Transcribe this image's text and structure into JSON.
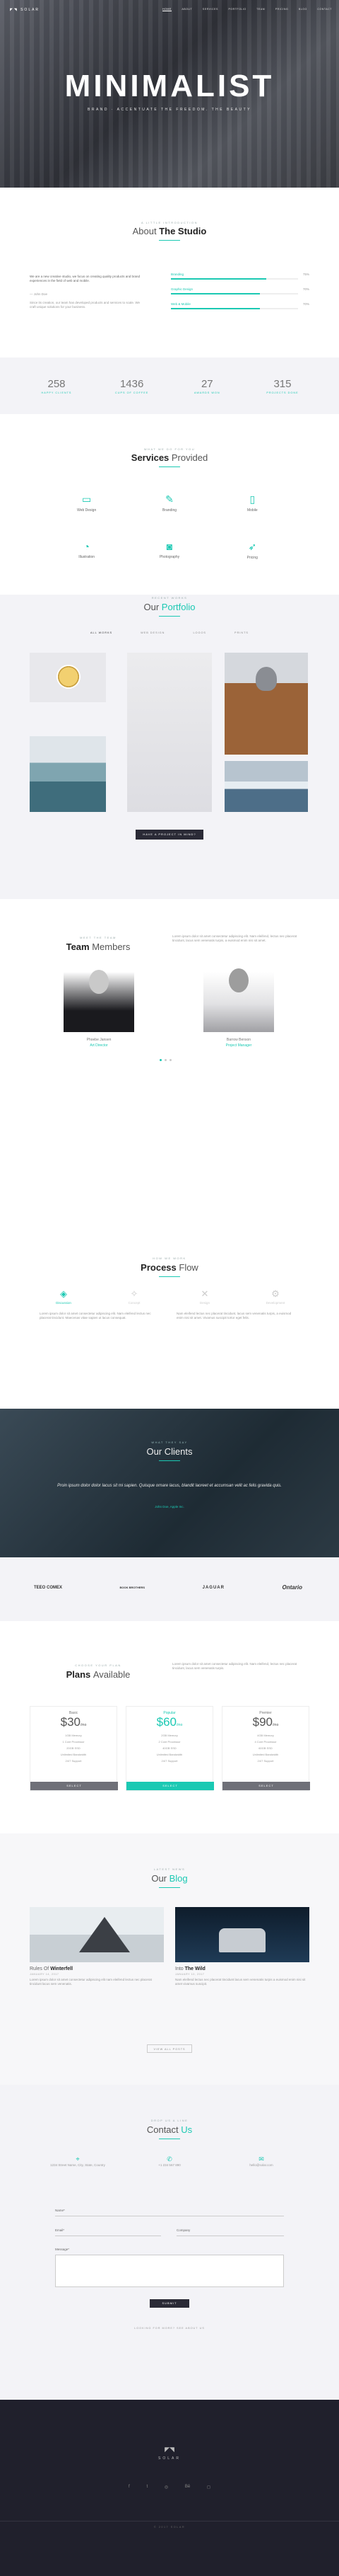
{
  "colors": {
    "accent": "#1bc9b3",
    "dark": "#222230",
    "light_bg": "#f3f3f7"
  },
  "nav": {
    "logo": "SOLAR",
    "items": [
      "HOME",
      "ABOUT",
      "SERVICES",
      "PORTFOLIO",
      "TEAM",
      "PRICING",
      "BLOG",
      "CONTACT"
    ]
  },
  "hero": {
    "title": "MINIMALIST",
    "subtitle": "BRAND · ACCENTUATE THE FREEDOM. THE BEAUTY"
  },
  "about": {
    "kicker": "A LITTLE INTRODUCTION",
    "title_a": "About ",
    "title_b": "The Studio",
    "quote": "We are a new creative studio, we focus on creating quality products and brand experiences in the field of web and mobile.",
    "author": "— John Doe",
    "body": "Since its creation, our team has developed products and services to scale. We craft unique solutions for your business.",
    "skills": [
      {
        "name": "Branding",
        "pct": "75%",
        "value": 0.75
      },
      {
        "name": "Graphic Design",
        "pct": "70%",
        "value": 0.7
      },
      {
        "name": "Web & Mobile",
        "pct": "70%",
        "value": 0.7
      }
    ]
  },
  "stats": [
    {
      "num": "258",
      "label": "HAPPY CLIENTS"
    },
    {
      "num": "1436",
      "label": "CUPS OF COFFEE"
    },
    {
      "num": "27",
      "label": "AWARDS WON"
    },
    {
      "num": "315",
      "label": "PROJECTS DONE"
    }
  ],
  "services": {
    "kicker": "WHAT WE DO FOR YOU",
    "title_a": "Services ",
    "title_b": "Provided",
    "items": [
      {
        "icon": "monitor-icon",
        "label": "Web Design"
      },
      {
        "icon": "pen-icon",
        "label": "Branding"
      },
      {
        "icon": "phone-icon",
        "label": "Mobile"
      },
      {
        "icon": "pie-icon",
        "label": "Illustration"
      },
      {
        "icon": "camera-icon",
        "label": "Photography"
      },
      {
        "icon": "rocket-icon",
        "label": "Pricing"
      }
    ]
  },
  "portfolio": {
    "kicker": "RECENT WORKS",
    "title_a": "Our ",
    "title_b": "Portfolio",
    "filters": [
      "ALL WORKS",
      "WEB DESIGN",
      "LOGOS",
      "PRINTS"
    ],
    "button": "HAVE A PROJECT IN MIND?"
  },
  "team": {
    "kicker": "MEET THE TEAM",
    "title_a": "Team ",
    "title_b": "Members",
    "intro": "Lorem ipsum dolor sit amet consectetur adipiscing elit. Nam eleifend, lectus nec placerat tincidunt, lacus sem venenatis turpis, a euismod enim nisi sit amet.",
    "members": [
      {
        "name": "Phoebe Jansen",
        "role": "Art Director"
      },
      {
        "name": "Barrow Benson",
        "role": "Project Manager"
      }
    ]
  },
  "process": {
    "kicker": "HOW WE WORK",
    "title_a": "Process ",
    "title_b": "Flow",
    "steps": [
      "Discussion",
      "Concept",
      "Design",
      "Development"
    ],
    "text1": "Lorem ipsum dolor sit amet consectetur adipiscing elit. Nam eleifend lectus nec placerat tincidunt. Maecenas vitae sapien ut lacus consequat.",
    "text2": "Nam eleifend lectus nec placerat tincidunt, lacus sem venenatis turpis, a euismod enim nisi sit amet. Vivamus suscipit tortor eget felis."
  },
  "clients": {
    "kicker": "WHAT THEY SAY",
    "title_a": "Our ",
    "title_b": "Clients",
    "quote": "Proin ipsum dolor dolor lacus sit mi sapien. Quisque ornare lacus, blandit laoreet et accumsan velit ac felis gravida quis.",
    "author": "John Doe, Apple Inc.",
    "logos": [
      "TEEO COMEX",
      "BOOK BROTHERS",
      "JAGUAR",
      "Ontario"
    ]
  },
  "pricing": {
    "kicker": "CHOOSE YOUR PLAN",
    "title_a": "Plans ",
    "title_b": "Available",
    "intro": "Lorem ipsum dolor sit amet consectetur adipiscing elit. Nam eleifend, lectus nec placerat tincidunt, lacus sem venenatis turpis.",
    "plans": [
      {
        "name": "Basic",
        "price": "$30",
        "per": "/mo",
        "features": [
          "1GB Memory",
          "1 Core Processor",
          "20GB SSD",
          "Unlimited Bandwidth",
          "24/7 Support"
        ],
        "button": "SELECT"
      },
      {
        "name": "Popular",
        "price": "$60",
        "per": "/mo",
        "features": [
          "2GB Memory",
          "2 Core Processor",
          "40GB SSD",
          "Unlimited Bandwidth",
          "24/7 Support"
        ],
        "button": "SELECT"
      },
      {
        "name": "Premier",
        "price": "$90",
        "per": "/mo",
        "features": [
          "4GB Memory",
          "4 Core Processor",
          "60GB SSD",
          "Unlimited Bandwidth",
          "24/7 Support"
        ],
        "button": "SELECT"
      }
    ]
  },
  "blog": {
    "kicker": "LATEST NEWS",
    "title_a": "Our ",
    "title_b": "Blog",
    "posts": [
      {
        "title_a": "Rules Of ",
        "title_b": "Winterfell",
        "meta": "JANUARY 14, 2017",
        "excerpt": "Lorem ipsum dolor sit amet consectetur adipiscing elit nam eleifend lectus nec placerat tincidunt lacus sem venenatis."
      },
      {
        "title_a": "Into ",
        "title_b": "The Wild",
        "meta": "JANUARY 10, 2017",
        "excerpt": "Nam eleifend lectus nec placerat tincidunt lacus sem venenatis turpis a euismod enim nisi sit amet vivamus suscipit."
      }
    ],
    "button": "VIEW ALL POSTS"
  },
  "contact": {
    "kicker": "DROP US A LINE",
    "title_a": "Contact ",
    "title_b": "Us",
    "info": [
      {
        "icon": "pin-icon",
        "text": "1234 Street Name, City, State, Country"
      },
      {
        "icon": "phone-icon",
        "text": "+1 234 567 890"
      },
      {
        "icon": "mail-icon",
        "text": "hello@solar.com"
      }
    ],
    "fields": {
      "name": "Name*",
      "email": "Email*",
      "company": "Company",
      "message": "Message*"
    },
    "button": "SUBMIT",
    "note": "LOOKING FOR MORE? SEE ABOUT US"
  },
  "footer": {
    "logo": "SOLAR",
    "copyright": "© 2017 SOLAR"
  }
}
